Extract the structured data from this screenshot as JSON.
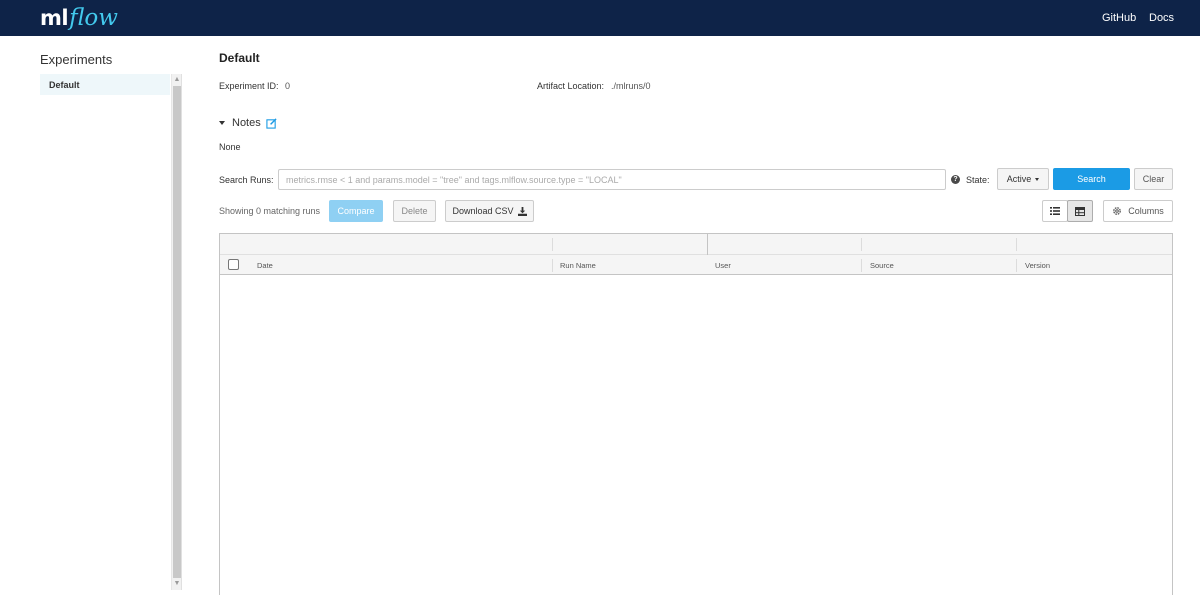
{
  "header": {
    "logo": {
      "part1": "ml",
      "part2": "flow"
    },
    "links": {
      "github": "GitHub",
      "docs": "Docs"
    }
  },
  "sidebar": {
    "title": "Experiments",
    "items": [
      {
        "label": "Default",
        "selected": true
      }
    ]
  },
  "main": {
    "title": "Default",
    "experiment_id_label": "Experiment ID:",
    "experiment_id": "0",
    "artifact_location_label": "Artifact Location:",
    "artifact_location": "./mlruns/0",
    "notes": {
      "label": "Notes",
      "content": "None"
    },
    "search": {
      "label": "Search Runs:",
      "placeholder": "metrics.rmse < 1 and params.model = \"tree\" and tags.mlflow.source.type = \"LOCAL\"",
      "value": "",
      "help": "?",
      "state_label": "State:",
      "state_value": "Active",
      "search_button": "Search",
      "clear_button": "Clear"
    },
    "toolbar": {
      "showing_text": "Showing 0 matching runs",
      "compare": "Compare",
      "delete": "Delete",
      "download_csv": "Download CSV",
      "columns": "Columns"
    },
    "table": {
      "columns": [
        "Date",
        "Run Name",
        "User",
        "Source",
        "Version"
      ],
      "rows": []
    }
  },
  "colors": {
    "header_bg": "#0e2348",
    "logo_accent": "#43c9ed",
    "primary": "#1b9be5",
    "primary_disabled": "#8fd0f3",
    "selected_item_bg": "#eef7fa"
  }
}
